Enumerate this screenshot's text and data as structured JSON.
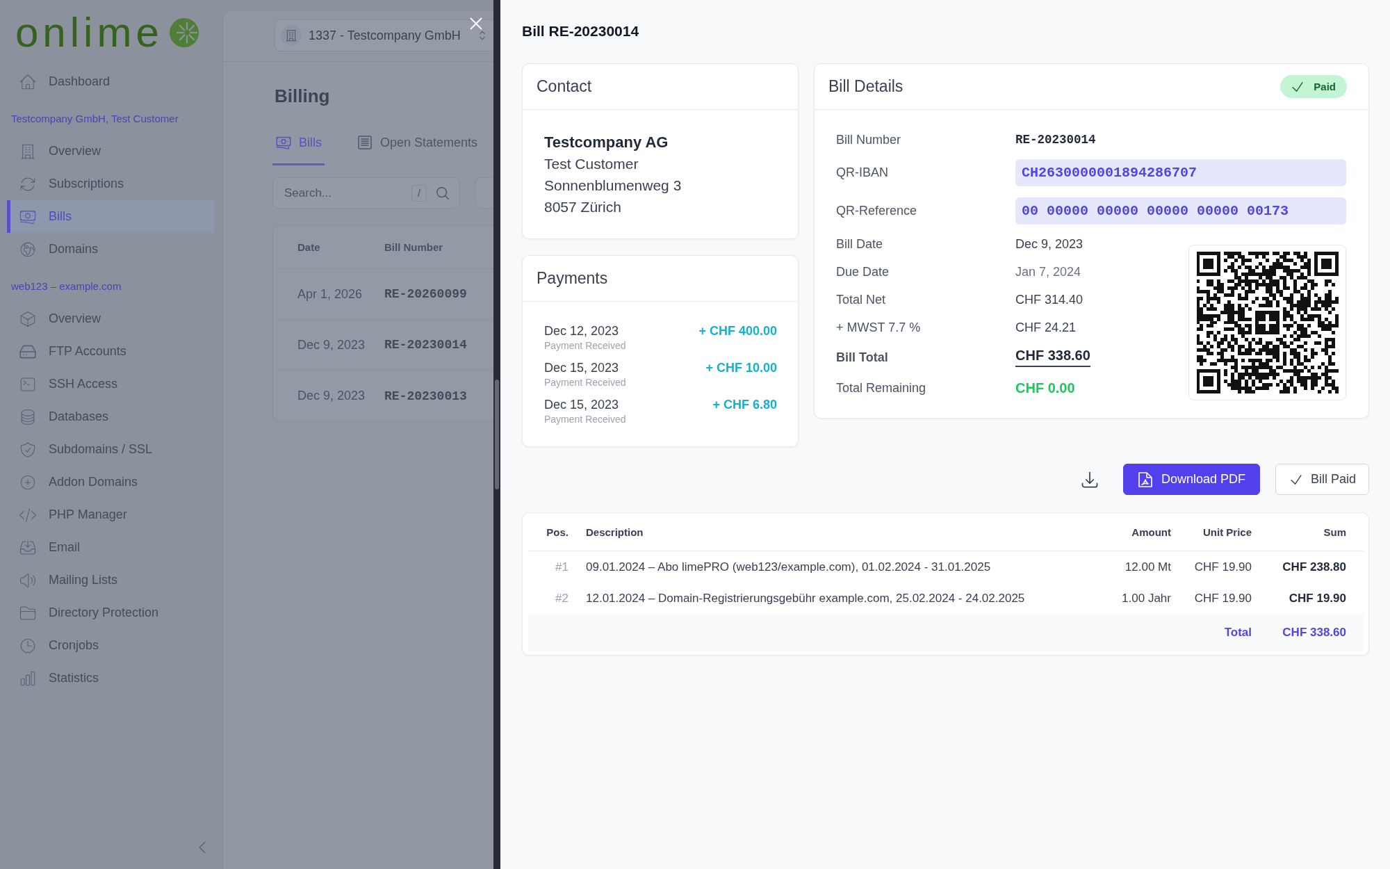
{
  "sidebar": {
    "logo": "onlime",
    "items": [
      {
        "label": "Dashboard",
        "selected": false
      }
    ],
    "sections": [
      {
        "title": "Testcompany GmbH, Test Customer",
        "items": [
          {
            "label": "Overview",
            "selected": false
          },
          {
            "label": "Subscriptions",
            "selected": false
          },
          {
            "label": "Bills",
            "selected": true
          },
          {
            "label": "Domains",
            "selected": false
          }
        ]
      },
      {
        "title": "web123 – example.com",
        "items": [
          {
            "label": "Overview",
            "selected": false
          },
          {
            "label": "FTP Accounts",
            "selected": false
          },
          {
            "label": "SSH Access",
            "selected": false
          },
          {
            "label": "Databases",
            "selected": false
          },
          {
            "label": "Subdomains / SSL",
            "selected": false
          },
          {
            "label": "Addon Domains",
            "selected": false
          },
          {
            "label": "PHP Manager",
            "selected": false
          },
          {
            "label": "Email",
            "selected": false
          },
          {
            "label": "Mailing Lists",
            "selected": false
          },
          {
            "label": "Directory Protection",
            "selected": false
          },
          {
            "label": "Cronjobs",
            "selected": false
          },
          {
            "label": "Statistics",
            "selected": false
          }
        ]
      }
    ]
  },
  "account_selector": {
    "value": "1337 - Testcompany GmbH"
  },
  "page_title": "Billing",
  "tabs": [
    {
      "label": "Bills",
      "selected": true
    },
    {
      "label": "Open Statements",
      "selected": false
    }
  ],
  "search": {
    "placeholder": "Search...",
    "shortcut": "/"
  },
  "bills_table": {
    "columns": [
      "Date",
      "Bill Number"
    ],
    "rows": [
      {
        "date": "Apr 1, 2026",
        "number": "RE-20260099"
      },
      {
        "date": "Dec 9, 2023",
        "number": "RE-20230014"
      },
      {
        "date": "Dec 9, 2023",
        "number": "RE-20230013"
      }
    ]
  },
  "drawer": {
    "title": "Bill RE-20230014",
    "contact": {
      "title": "Contact",
      "company": "Testcompany AG",
      "lines": [
        "Test Customer",
        "Sonnenblumenweg 3",
        "8057 Zürich"
      ]
    },
    "payments": {
      "title": "Payments",
      "items": [
        {
          "date": "Dec 12, 2023",
          "label": "Payment Received",
          "amount": "+ CHF 400.00"
        },
        {
          "date": "Dec 15, 2023",
          "label": "Payment Received",
          "amount": "+ CHF 10.00"
        },
        {
          "date": "Dec 15, 2023",
          "label": "Payment Received",
          "amount": "+ CHF 6.80"
        }
      ]
    },
    "bill_details": {
      "title": "Bill Details",
      "status": {
        "label": "Paid",
        "paid": true
      },
      "references": [
        {
          "label": "Bill Number",
          "value": "RE-20230014",
          "kind": "mono"
        },
        {
          "label": "QR-IBAN",
          "value": "CH2630000001894286707",
          "kind": "code"
        },
        {
          "label": "QR-Reference",
          "value": "00 00000 00000 00000 00000 00173",
          "kind": "code"
        }
      ],
      "rows": [
        {
          "label": "Bill Date",
          "value": "Dec 9, 2023",
          "kind": "text"
        },
        {
          "label": "Due Date",
          "value": "Jan 7, 2024",
          "kind": "muted"
        },
        {
          "label": "Total Net",
          "value": "CHF 314.40",
          "kind": "text"
        },
        {
          "label": "+ MWST 7.7 %",
          "value": "CHF 24.21",
          "kind": "text"
        },
        {
          "label": "Bill Total",
          "value": "CHF 338.60",
          "kind": "total"
        },
        {
          "label": "Total Remaining",
          "value": "CHF 0.00",
          "kind": "remaining"
        }
      ]
    },
    "actions": [
      {
        "label": "Download PDF",
        "kind": "primary"
      },
      {
        "label": "Bill Paid",
        "kind": "secondary"
      }
    ],
    "line_items": {
      "columns": [
        "Pos.",
        "Description",
        "Amount",
        "Unit Price",
        "Sum"
      ],
      "rows": [
        {
          "pos": "#1",
          "description": "09.01.2024 – Abo limePRO (web123/example.com), 01.02.2024 - 31.01.2025",
          "amount": "12.00 Mt",
          "unit_price": "CHF 19.90",
          "sum": "CHF 238.80"
        },
        {
          "pos": "#2",
          "description": "12.01.2024 – Domain-Registrierungsgebühr example.com, 25.02.2024 - 24.02.2025",
          "amount": "1.00 Jahr",
          "unit_price": "CHF 19.90",
          "sum": "CHF 19.90"
        }
      ],
      "total": {
        "label": "Total",
        "value": "CHF 338.60"
      }
    }
  }
}
